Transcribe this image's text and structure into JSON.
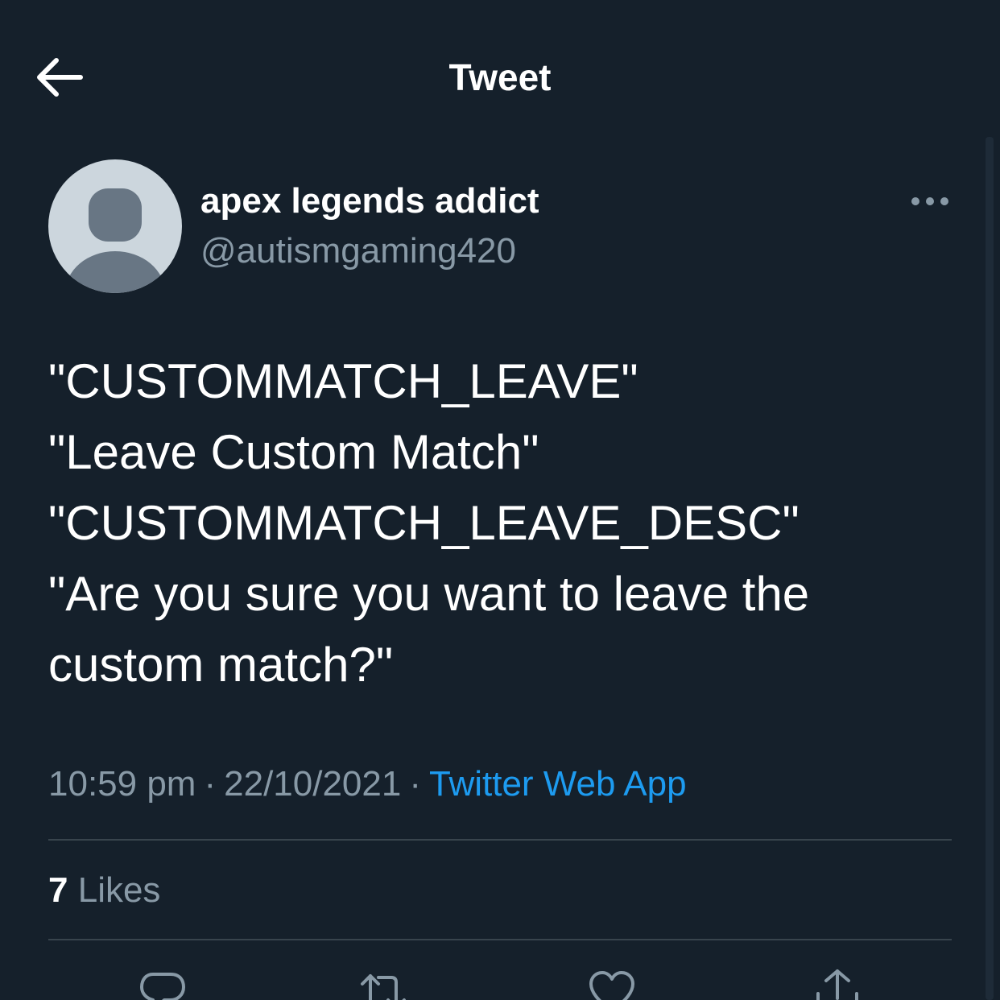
{
  "header": {
    "title": "Tweet",
    "back_icon": "arrow-left-icon"
  },
  "author": {
    "display_name": "apex legends addict",
    "handle": "@autismgaming420",
    "avatar_icon": "default-avatar-icon"
  },
  "tweet": {
    "lines": [
      "\"CUSTOMMATCH_LEAVE\"",
      "\"Leave Custom Match\"",
      "\"CUSTOMMATCH_LEAVE_DESC\"",
      "\"Are you sure you want to leave the",
      "custom match?\""
    ],
    "time": "10:59 pm",
    "date": "22/10/2021",
    "separator": "·",
    "source": "Twitter Web App"
  },
  "stats": {
    "likes_count": "7",
    "likes_label": "Likes"
  },
  "actions": [
    "reply-icon",
    "retweet-icon",
    "like-icon",
    "share-icon"
  ],
  "colors": {
    "background": "#15202b",
    "primary_text": "#ffffff",
    "secondary_text": "#8899a6",
    "link": "#1d9bf0",
    "divider": "#38444d",
    "avatar_bg": "#ccd6dd",
    "avatar_fg": "#687684"
  }
}
